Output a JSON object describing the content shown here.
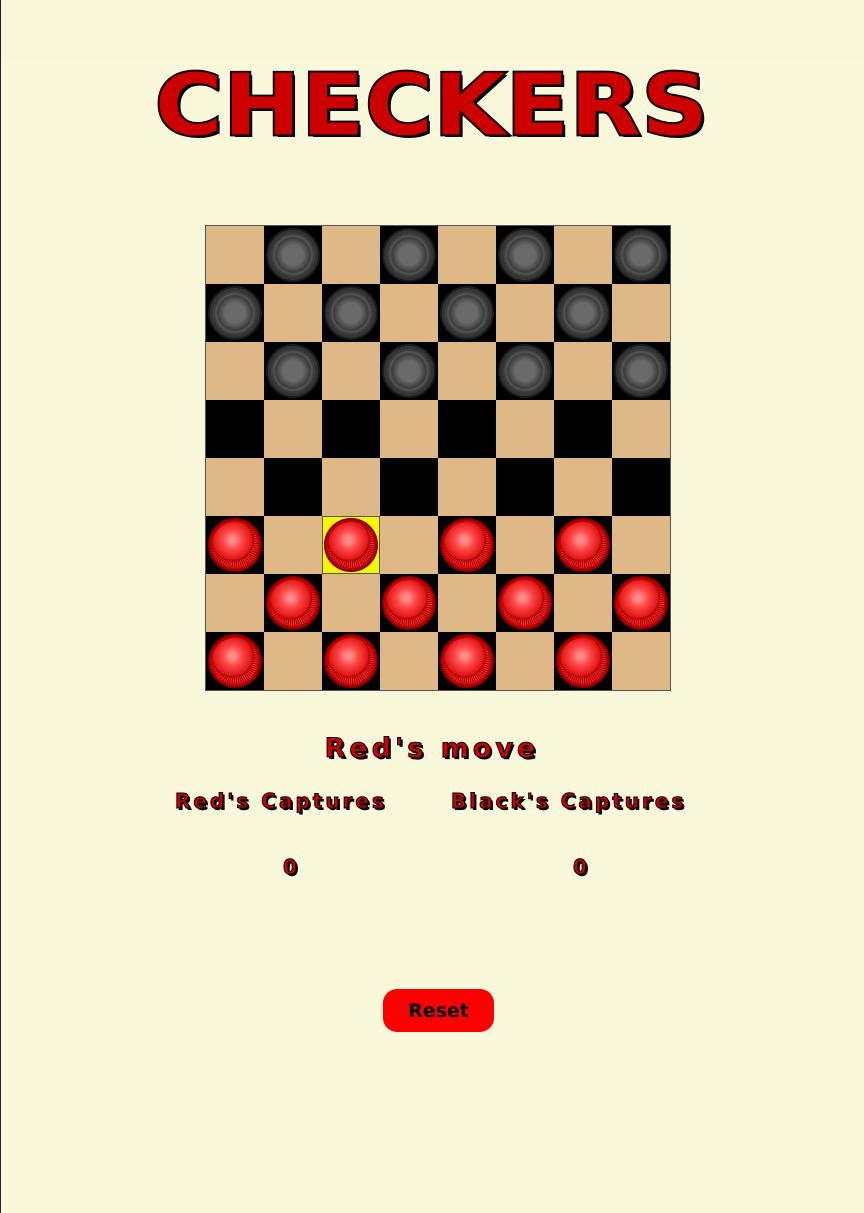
{
  "title": "CHECKERS",
  "board": {
    "rows": [
      [
        "",
        "b",
        "",
        "b",
        "",
        "b",
        "",
        "b"
      ],
      [
        "b",
        "",
        "b",
        "",
        "b",
        "",
        "b",
        ""
      ],
      [
        "",
        "b",
        "",
        "b",
        "",
        "b",
        "",
        "b"
      ],
      [
        "",
        "",
        "",
        "",
        "",
        "",
        "",
        ""
      ],
      [
        "",
        "",
        "",
        "",
        "",
        "",
        "",
        ""
      ],
      [
        "r",
        "",
        "r",
        "",
        "r",
        "",
        "r",
        ""
      ],
      [
        "",
        "r",
        "",
        "r",
        "",
        "r",
        "",
        "r"
      ],
      [
        "r",
        "",
        "r",
        "",
        "r",
        "",
        "r",
        ""
      ]
    ],
    "selected": [
      5,
      2
    ],
    "colors": {
      "light_square": "#deb887",
      "dark_square": "#000000",
      "selected_square": "#f7f700",
      "red_piece": "#e01818",
      "black_piece": "#4a4a4a"
    }
  },
  "status": {
    "turn_text": "Red's move"
  },
  "captures": {
    "red_label": "Red's Captures",
    "black_label": "Black's Captures",
    "red_count": "0",
    "black_count": "0"
  },
  "controls": {
    "reset_label": "Reset",
    "reset_color": "#ff0000"
  }
}
